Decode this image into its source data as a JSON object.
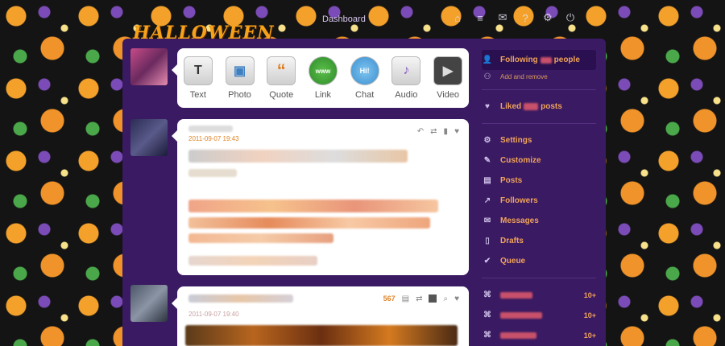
{
  "header": {
    "logo_text": "HALLOWEEN",
    "dashboard_label": "Dashboard",
    "icons": [
      "home-icon",
      "list-icon",
      "mail-icon",
      "help-icon",
      "gear-icon",
      "power-icon"
    ]
  },
  "composer": {
    "types": [
      {
        "label": "Text",
        "glyph": "T"
      },
      {
        "label": "Photo",
        "glyph": "▣"
      },
      {
        "label": "Quote",
        "glyph": "“"
      },
      {
        "label": "Link",
        "glyph": "www"
      },
      {
        "label": "Chat",
        "glyph": "Hi!"
      },
      {
        "label": "Audio",
        "glyph": "♪"
      },
      {
        "label": "Video",
        "glyph": "▶"
      }
    ]
  },
  "posts": [
    {
      "date": "2011-09-07 19:43"
    },
    {
      "date": "2011-09-07 19:40",
      "notes": "567"
    }
  ],
  "sidebar": {
    "following_label": "Following",
    "following_label_tail": "people",
    "add_remove": "Add and remove",
    "liked_label": "Liked",
    "liked_label_tail": "posts",
    "menu": [
      {
        "label": "Settings",
        "icon": "gear-icon"
      },
      {
        "label": "Customize",
        "icon": "wrench-icon"
      },
      {
        "label": "Posts",
        "icon": "document-icon"
      },
      {
        "label": "Followers",
        "icon": "chart-icon"
      },
      {
        "label": "Messages",
        "icon": "mail-icon"
      },
      {
        "label": "Drafts",
        "icon": "drafts-icon"
      },
      {
        "label": "Queue",
        "icon": "queue-icon"
      }
    ],
    "tag_counts": [
      "10+",
      "10+",
      "10+"
    ]
  }
}
